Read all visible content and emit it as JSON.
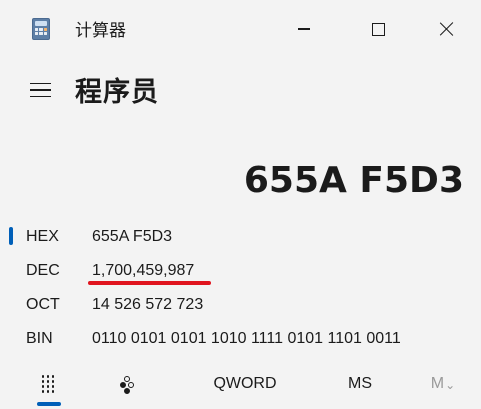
{
  "window": {
    "title": "计算器",
    "icon": "calculator-icon"
  },
  "header": {
    "mode_title": "程序员",
    "menu_icon": "hamburger-menu-icon"
  },
  "display": {
    "value": "655A F5D3"
  },
  "radix": [
    {
      "label": "HEX",
      "value": "655A F5D3",
      "selected": true
    },
    {
      "label": "DEC",
      "value": "1,700,459,987",
      "selected": false
    },
    {
      "label": "OCT",
      "value": "14 526 572 723",
      "selected": false
    },
    {
      "label": "BIN",
      "value": "0110 0101 0101 1010 1111 0101 1101 0011",
      "selected": false
    }
  ],
  "annotation": {
    "underline_color": "#e0141e",
    "underline_target": "DEC"
  },
  "toolbar": {
    "keypad_icon": "full-keypad-icon",
    "bitflip_icon": "bit-toggling-keypad-icon",
    "word_size": "QWORD",
    "memory_store": "MS",
    "memory_view": "M",
    "memory_view_chevron": "chevron-down-icon"
  },
  "colors": {
    "accent": "#005fb8",
    "background": "#f3f3f3",
    "text": "#1b1b1b",
    "disabled": "#9a9a9a"
  }
}
